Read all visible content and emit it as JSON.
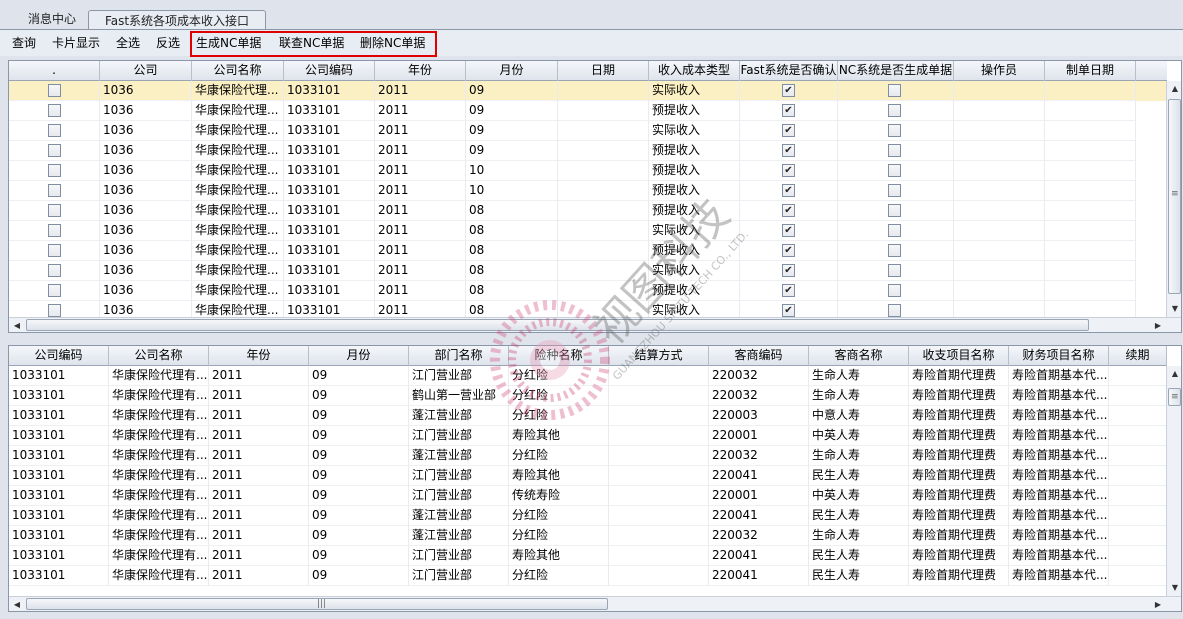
{
  "tabs": [
    {
      "label": "消息中心"
    },
    {
      "label": "Fast系统各项成本收入接口"
    }
  ],
  "toolbar": {
    "query": "查询",
    "card_view": "卡片显示",
    "select_all": "全选",
    "invert_select": "反选",
    "generate_nc": "生成NC单据",
    "link_nc": "联查NC单据",
    "delete_nc": "删除NC单据"
  },
  "top_grid": {
    "columns": [
      ".",
      "公司",
      "公司名称",
      "公司编码",
      "年份",
      "月份",
      "日期",
      "收入成本类型",
      "Fast系统是否确认",
      "NC系统是否生成单据",
      "操作员",
      "制单日期"
    ],
    "rows": [
      {
        "company": "1036",
        "company_name": "华康保险代理...",
        "company_code": "1033101",
        "year": "2011",
        "month": "09",
        "date": "",
        "type": "实际收入",
        "fast_confirmed": true,
        "nc_generated": false,
        "operator": "",
        "make_date": "",
        "selected": true
      },
      {
        "company": "1036",
        "company_name": "华康保险代理...",
        "company_code": "1033101",
        "year": "2011",
        "month": "09",
        "date": "",
        "type": "预提收入",
        "fast_confirmed": true,
        "nc_generated": false,
        "operator": "",
        "make_date": ""
      },
      {
        "company": "1036",
        "company_name": "华康保险代理...",
        "company_code": "1033101",
        "year": "2011",
        "month": "09",
        "date": "",
        "type": "实际收入",
        "fast_confirmed": true,
        "nc_generated": false,
        "operator": "",
        "make_date": ""
      },
      {
        "company": "1036",
        "company_name": "华康保险代理...",
        "company_code": "1033101",
        "year": "2011",
        "month": "09",
        "date": "",
        "type": "预提收入",
        "fast_confirmed": true,
        "nc_generated": false,
        "operator": "",
        "make_date": ""
      },
      {
        "company": "1036",
        "company_name": "华康保险代理...",
        "company_code": "1033101",
        "year": "2011",
        "month": "10",
        "date": "",
        "type": "预提收入",
        "fast_confirmed": true,
        "nc_generated": false,
        "operator": "",
        "make_date": ""
      },
      {
        "company": "1036",
        "company_name": "华康保险代理...",
        "company_code": "1033101",
        "year": "2011",
        "month": "10",
        "date": "",
        "type": "预提收入",
        "fast_confirmed": true,
        "nc_generated": false,
        "operator": "",
        "make_date": ""
      },
      {
        "company": "1036",
        "company_name": "华康保险代理...",
        "company_code": "1033101",
        "year": "2011",
        "month": "08",
        "date": "",
        "type": "预提收入",
        "fast_confirmed": true,
        "nc_generated": false,
        "operator": "",
        "make_date": ""
      },
      {
        "company": "1036",
        "company_name": "华康保险代理...",
        "company_code": "1033101",
        "year": "2011",
        "month": "08",
        "date": "",
        "type": "实际收入",
        "fast_confirmed": true,
        "nc_generated": false,
        "operator": "",
        "make_date": ""
      },
      {
        "company": "1036",
        "company_name": "华康保险代理...",
        "company_code": "1033101",
        "year": "2011",
        "month": "08",
        "date": "",
        "type": "预提收入",
        "fast_confirmed": true,
        "nc_generated": false,
        "operator": "",
        "make_date": ""
      },
      {
        "company": "1036",
        "company_name": "华康保险代理...",
        "company_code": "1033101",
        "year": "2011",
        "month": "08",
        "date": "",
        "type": "实际收入",
        "fast_confirmed": true,
        "nc_generated": false,
        "operator": "",
        "make_date": ""
      },
      {
        "company": "1036",
        "company_name": "华康保险代理...",
        "company_code": "1033101",
        "year": "2011",
        "month": "08",
        "date": "",
        "type": "预提收入",
        "fast_confirmed": true,
        "nc_generated": false,
        "operator": "",
        "make_date": ""
      },
      {
        "company": "1036",
        "company_name": "华康保险代理...",
        "company_code": "1033101",
        "year": "2011",
        "month": "08",
        "date": "",
        "type": "实际收入",
        "fast_confirmed": true,
        "nc_generated": false,
        "operator": "",
        "make_date": ""
      }
    ]
  },
  "bottom_grid": {
    "columns": [
      "公司编码",
      "公司名称",
      "年份",
      "月份",
      "部门名称",
      "险种名称",
      "结算方式",
      "客商编码",
      "客商名称",
      "收支项目名称",
      "财务项目名称",
      "续期"
    ],
    "rows": [
      [
        "1033101",
        "华康保险代理有...",
        "2011",
        "09",
        "江门营业部",
        "分红险",
        "",
        "220032",
        "生命人寿",
        "寿险首期代理费",
        "寿险首期基本代..."
      ],
      [
        "1033101",
        "华康保险代理有...",
        "2011",
        "09",
        "鹤山第一营业部",
        "分红险",
        "",
        "220032",
        "生命人寿",
        "寿险首期代理费",
        "寿险首期基本代..."
      ],
      [
        "1033101",
        "华康保险代理有...",
        "2011",
        "09",
        "蓬江营业部",
        "分红险",
        "",
        "220003",
        "中意人寿",
        "寿险首期代理费",
        "寿险首期基本代..."
      ],
      [
        "1033101",
        "华康保险代理有...",
        "2011",
        "09",
        "江门营业部",
        "寿险其他",
        "",
        "220001",
        "中英人寿",
        "寿险首期代理费",
        "寿险首期基本代..."
      ],
      [
        "1033101",
        "华康保险代理有...",
        "2011",
        "09",
        "蓬江营业部",
        "分红险",
        "",
        "220032",
        "生命人寿",
        "寿险首期代理费",
        "寿险首期基本代..."
      ],
      [
        "1033101",
        "华康保险代理有...",
        "2011",
        "09",
        "江门营业部",
        "寿险其他",
        "",
        "220041",
        "民生人寿",
        "寿险首期代理费",
        "寿险首期基本代..."
      ],
      [
        "1033101",
        "华康保险代理有...",
        "2011",
        "09",
        "江门营业部",
        "传统寿险",
        "",
        "220001",
        "中英人寿",
        "寿险首期代理费",
        "寿险首期基本代..."
      ],
      [
        "1033101",
        "华康保险代理有...",
        "2011",
        "09",
        "蓬江营业部",
        "分红险",
        "",
        "220041",
        "民生人寿",
        "寿险首期代理费",
        "寿险首期基本代..."
      ],
      [
        "1033101",
        "华康保险代理有...",
        "2011",
        "09",
        "蓬江营业部",
        "分红险",
        "",
        "220032",
        "生命人寿",
        "寿险首期代理费",
        "寿险首期基本代..."
      ],
      [
        "1033101",
        "华康保险代理有...",
        "2011",
        "09",
        "江门营业部",
        "寿险其他",
        "",
        "220041",
        "民生人寿",
        "寿险首期代理费",
        "寿险首期基本代..."
      ],
      [
        "1033101",
        "华康保险代理有...",
        "2011",
        "09",
        "江门营业部",
        "分红险",
        "",
        "220041",
        "民生人寿",
        "寿险首期代理费",
        "寿险首期基本代..."
      ]
    ]
  },
  "watermark": {
    "cn": "视图科技",
    "en": "GUANGZHOU SHITU TECH CO., LTD."
  },
  "colors": {
    "selected_row": "#fbf0c4",
    "highlight_box": "#e00000",
    "background": "#dfe4ec"
  }
}
